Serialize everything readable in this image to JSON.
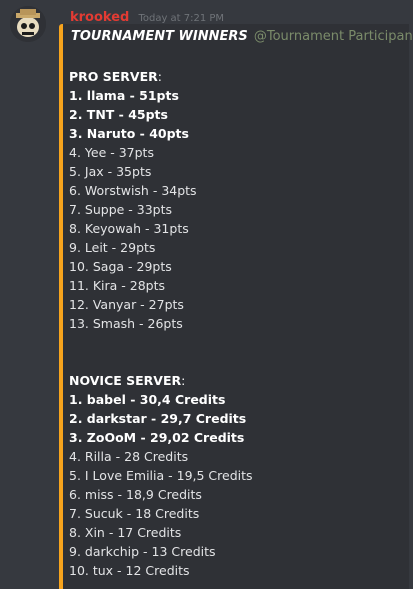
{
  "message": {
    "username": "krooked",
    "timestamp": "Today at 7:21 PM",
    "embed": {
      "title": "TOURNAMENT WINNERS",
      "mention": "@Tournament Participant",
      "accent_color": "#f7a41d",
      "sections": [
        {
          "title": "PRO SERVER",
          "rows": [
            {
              "text": "1. llama - 51pts",
              "bold": true
            },
            {
              "text": "2. TNT - 45pts",
              "bold": true
            },
            {
              "text": "3. Naruto - 40pts",
              "bold": true
            },
            {
              "text": "4. Yee - 37pts",
              "bold": false
            },
            {
              "text": "5. Jax - 35pts",
              "bold": false
            },
            {
              "text": "6. Worstwish - 34pts",
              "bold": false
            },
            {
              "text": "7. Suppe - 33pts",
              "bold": false
            },
            {
              "text": "8. Keyowah - 31pts",
              "bold": false
            },
            {
              "text": "9. Leit  - 29pts",
              "bold": false
            },
            {
              "text": "10. Saga - 29pts",
              "bold": false
            },
            {
              "text": "11. Kira - 28pts",
              "bold": false
            },
            {
              "text": "12. Vanyar - 27pts",
              "bold": false
            },
            {
              "text": "13. Smash - 26pts",
              "bold": false
            }
          ]
        },
        {
          "title": "NOVICE SERVER",
          "rows": [
            {
              "text": "1. babel - 30,4 Credits",
              "bold": true
            },
            {
              "text": "2. darkstar - 29,7 Credits",
              "bold": true
            },
            {
              "text": "3. ZoOoM - 29,02 Credits",
              "bold": true
            },
            {
              "text": "4. Rilla - 28 Credits",
              "bold": false
            },
            {
              "text": "5. I Love Emilia - 19,5 Credits",
              "bold": false
            },
            {
              "text": "6. miss - 18,9 Credits",
              "bold": false
            },
            {
              "text": "7. Sucuk - 18 Credits",
              "bold": false
            },
            {
              "text": "8. Xin - 17 Credits",
              "bold": false
            },
            {
              "text": "9. darkchip - 13 Credits",
              "bold": false
            },
            {
              "text": "10. tux - 12 Credits",
              "bold": false
            }
          ]
        }
      ]
    }
  },
  "colors": {
    "background": "#36393f",
    "embed_background": "#2f3136",
    "username": "#e23b33",
    "mention": "#7b8c6a"
  },
  "icons": {
    "avatar": "skull-with-hat-avatar-icon"
  }
}
